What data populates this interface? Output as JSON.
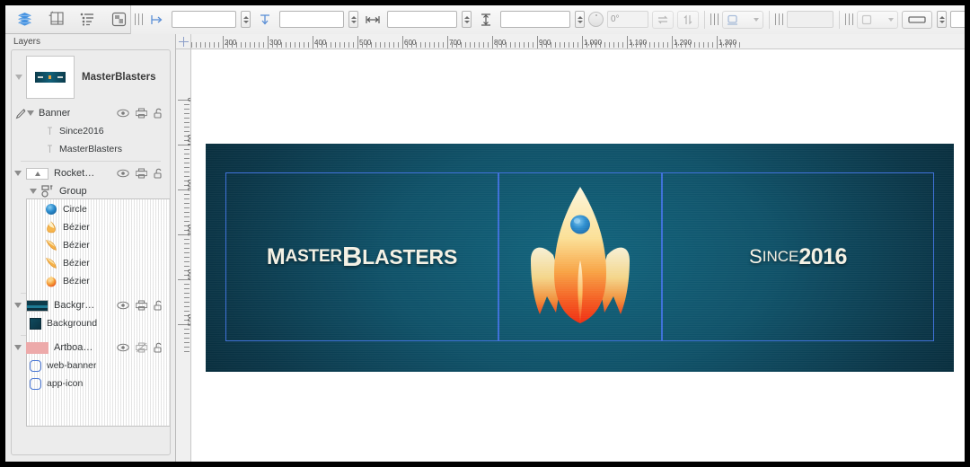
{
  "window": {
    "title": "MasterBlasters"
  },
  "toolbar": {
    "left_tools": [
      {
        "name": "layers-tool",
        "icon": "layers-stack-icon",
        "active": true
      },
      {
        "name": "artboard-tool",
        "icon": "artboard-icon",
        "active": false
      },
      {
        "name": "outline-list-tool",
        "icon": "outline-list-icon",
        "active": false
      },
      {
        "name": "symbol-tool",
        "icon": "symbol-icon",
        "active": false
      }
    ],
    "fields": [
      {
        "name": "x-position",
        "icon": "align-left-arrow-icon",
        "value": "",
        "placeholder": ""
      },
      {
        "name": "y-position",
        "icon": "align-top-arrow-icon",
        "value": "",
        "placeholder": ""
      },
      {
        "name": "width",
        "icon": "width-arrow-icon",
        "value": "",
        "placeholder": ""
      },
      {
        "name": "height",
        "icon": "height-arrow-icon",
        "value": "",
        "placeholder": ""
      }
    ],
    "rotation": {
      "name": "rotation-angle",
      "value": "0°"
    },
    "flip_horizontal_label": "flip-horizontal-icon",
    "flip_vertical_label": "flip-vertical-icon",
    "corner_popup": {
      "name": "corner-style-popup",
      "icon": "rounded-square-icon"
    },
    "dim_field": {
      "name": "corner-radius-field",
      "value": ""
    },
    "shape_popup": {
      "name": "shape-style-popup",
      "icon": "square-icon"
    },
    "stroke_popup": {
      "name": "stroke-style-popup",
      "icon": "line-style-icon"
    },
    "stroke_width": {
      "name": "stroke-width-field",
      "value": ""
    }
  },
  "layers": {
    "header_label": "Layers",
    "document": {
      "name": "MasterBlasters",
      "expanded": true,
      "thumbnail": "banner-thumbnail"
    },
    "rows": [
      {
        "indent": 0,
        "label": "Banner",
        "type": "group",
        "has_pencil": true,
        "expanded": true,
        "thumb": "banner",
        "icons": [
          "eye-icon",
          "print-icon",
          "unlock-icon"
        ]
      },
      {
        "indent": 2,
        "label": "Since2016",
        "type": "text",
        "has_pencil": false,
        "expanded": null,
        "thumb": "text",
        "icons": []
      },
      {
        "indent": 2,
        "label": "MasterBlasters",
        "type": "text",
        "has_pencil": false,
        "expanded": null,
        "thumb": "text",
        "icons": []
      },
      {
        "separator": true
      },
      {
        "indent": 0,
        "label": "Rocket…",
        "type": "group",
        "has_pencil": false,
        "expanded": true,
        "thumb": "rocket",
        "icons": [
          "eye-icon",
          "print-icon",
          "unlock-icon"
        ]
      },
      {
        "indent": 1,
        "label": "Group",
        "type": "group2",
        "has_pencil": false,
        "expanded": true,
        "thumb": "group",
        "icons": []
      },
      {
        "indent": 2,
        "label": "Circle",
        "type": "circle",
        "has_pencil": false,
        "expanded": null,
        "thumb": "circle",
        "icons": []
      },
      {
        "indent": 2,
        "label": "Bézier",
        "type": "bezier",
        "has_pencil": false,
        "expanded": null,
        "thumb": "bez-nose",
        "icons": []
      },
      {
        "indent": 2,
        "label": "Bézier",
        "type": "bezier",
        "has_pencil": false,
        "expanded": null,
        "thumb": "bez-fin",
        "icons": []
      },
      {
        "indent": 2,
        "label": "Bézier",
        "type": "bezier",
        "has_pencil": false,
        "expanded": null,
        "thumb": "bez-fin2",
        "icons": []
      },
      {
        "indent": 2,
        "label": "Bézier",
        "type": "bezier",
        "has_pencil": false,
        "expanded": null,
        "thumb": "bez-drop",
        "icons": []
      },
      {
        "separator": true
      },
      {
        "indent": 0,
        "label": "Backgr…",
        "type": "group",
        "has_pencil": false,
        "expanded": true,
        "thumb": "bg",
        "icons": [
          "eye-icon",
          "print-icon",
          "unlock-icon"
        ]
      },
      {
        "indent": 1,
        "label": "Background",
        "type": "rect",
        "has_pencil": false,
        "expanded": null,
        "thumb": "bgsq",
        "icons": []
      },
      {
        "separator": true
      },
      {
        "indent": 0,
        "label": "Artboa…",
        "type": "group",
        "has_pencil": false,
        "expanded": true,
        "thumb": "pink",
        "icons": [
          "eye-icon",
          "print-disabled-icon",
          "unlock-icon"
        ]
      },
      {
        "indent": 1,
        "label": "web-banner",
        "type": "rrect",
        "has_pencil": false,
        "expanded": null,
        "thumb": "rrect",
        "icons": []
      },
      {
        "indent": 1,
        "label": "app-icon",
        "type": "rrect",
        "has_pencil": false,
        "expanded": null,
        "thumb": "rrect",
        "icons": []
      }
    ]
  },
  "rulers": {
    "horizontal_labels": [
      "200",
      "300",
      "400",
      "500",
      "600",
      "700",
      "800",
      "900",
      "1,000",
      "1,100",
      "1,200",
      "1,3"
    ],
    "vertical_labels": [
      "0",
      "100",
      "200",
      "300",
      "400",
      "500"
    ],
    "unit": "px"
  },
  "canvas": {
    "artwork": {
      "title_left": {
        "big1": "M",
        "small1": "ASTER",
        "big2": "B",
        "small2": "LASTERS"
      },
      "title_right": {
        "big1": "S",
        "small1": "INCE",
        "bold": "2016"
      },
      "rocket_alt": "rocket-illustration"
    },
    "colors": {
      "banner_center": "#12647d",
      "banner_edge": "#072936",
      "selection_blue": "#3c6fd8",
      "text_cream": "#f4f1e4",
      "rocket_top": "#fdf3d6",
      "rocket_bottom": "#f0371a",
      "porthole_blue": "#2f8fd0"
    },
    "slices": [
      "web-banner-left",
      "app-icon-center",
      "web-banner-right"
    ]
  }
}
